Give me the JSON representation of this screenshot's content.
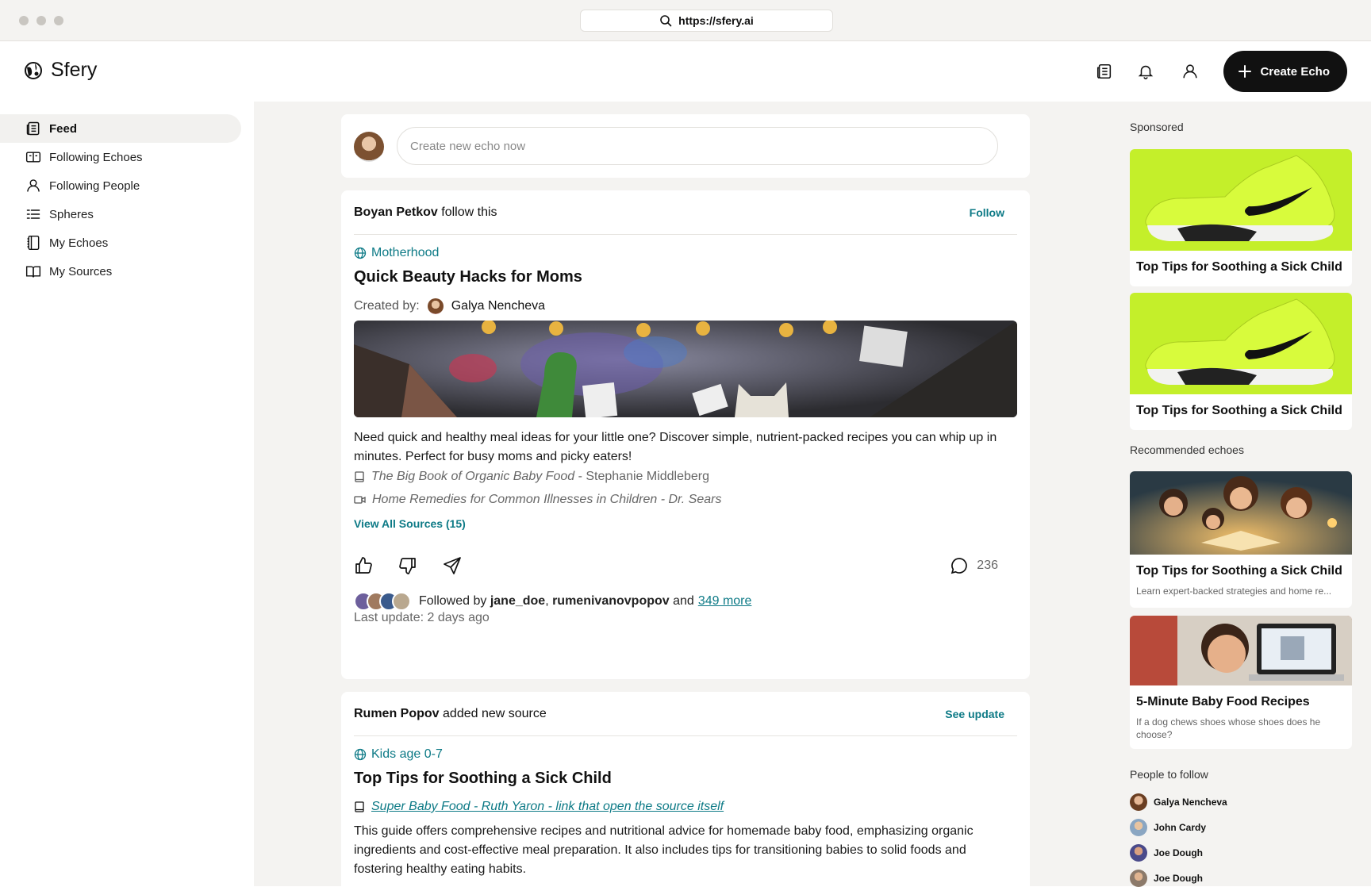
{
  "browser": {
    "url": "https://sfery.ai"
  },
  "app": {
    "name": "Sfery"
  },
  "header": {
    "create_label": "Create Echo"
  },
  "sidebar": {
    "items": [
      {
        "label": "Feed",
        "icon": "newspaper-icon",
        "active": true
      },
      {
        "label": "Following Echoes",
        "icon": "echoes-icon"
      },
      {
        "label": "Following People",
        "icon": "person-icon"
      },
      {
        "label": "Spheres",
        "icon": "list-icon"
      },
      {
        "label": "My Echoes",
        "icon": "notebook-icon"
      },
      {
        "label": "My Sources",
        "icon": "book-icon"
      }
    ]
  },
  "composer": {
    "placeholder": "Create new echo now"
  },
  "post1": {
    "actor": "Boyan Petkov",
    "action": "follow this",
    "action_button": "Follow",
    "sphere": "Motherhood",
    "title": "Quick Beauty Hacks for Moms",
    "created_by_label": "Created by:",
    "creator": "Galya Nencheva",
    "description": "Need quick and healthy meal ideas for your little one? Discover simple, nutrient-packed recipes you can whip up in minutes. Perfect for busy moms and picky eaters!",
    "sources": [
      {
        "title": "The Big Book of Organic Baby Food",
        "author": " - Stephanie Middleberg",
        "icon": "book-icon"
      },
      {
        "title": "Home Remedies for Common Illnesses in Children - Dr. Sears",
        "author": "",
        "icon": "video-icon"
      }
    ],
    "view_all": "View All Sources (15)",
    "comments": "236",
    "followed_by_label": "Followed by",
    "followers": [
      "jane_doe",
      "rumenivanovpopov"
    ],
    "and_label": "and",
    "more_label": "349 more",
    "last_update": "Last update: 2 days ago"
  },
  "post2": {
    "actor": "Rumen Popov",
    "action": "added new source",
    "action_button": "See update",
    "sphere": "Kids age 0-7",
    "title": "Top Tips for Soothing a Sick Child",
    "source_link": "Super Baby Food - Ruth Yaron - link that open the source itself",
    "description": "This guide offers comprehensive recipes and nutritional advice for homemade baby food, emphasizing organic ingredients and cost-effective meal preparation. It also includes tips for transitioning babies to solid foods and fostering healthy eating habits."
  },
  "right": {
    "sponsored_label": "Sponsored",
    "ads": [
      {
        "title": "Top Tips for Soothing a Sick Child"
      },
      {
        "title": "Top Tips for Soothing a Sick Child"
      }
    ],
    "recommended_label": "Recommended echoes",
    "recommended": [
      {
        "title": "Top Tips for Soothing a Sick Child",
        "subtitle": "Learn expert-backed strategies and home re..."
      },
      {
        "title": "5-Minute Baby Food Recipes",
        "subtitle": "If a dog chews shoes whose shoes does he choose?"
      }
    ],
    "people_label": "People to follow",
    "people": [
      {
        "name": "Galya Nencheva"
      },
      {
        "name": "John Cardy"
      },
      {
        "name": "Joe Dough"
      },
      {
        "name": "Joe Dough"
      }
    ]
  },
  "colors": {
    "accent": "#0d7a86",
    "background": "#f4f3f1",
    "primary_button": "#111111",
    "ad_green": "#c4ef2a"
  }
}
